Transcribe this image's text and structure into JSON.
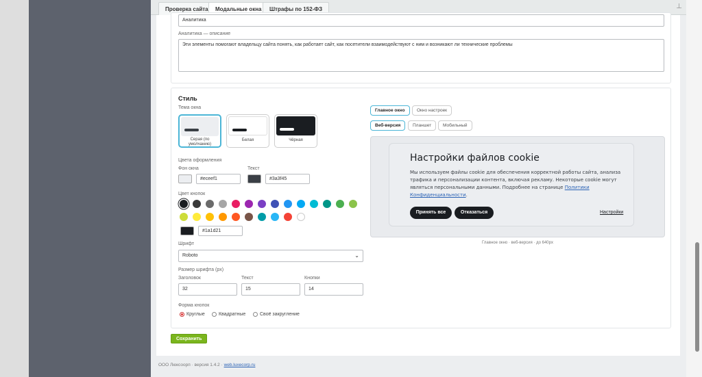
{
  "tabs": [
    {
      "label": "Проверка сайта"
    },
    {
      "label": "Модальные окна"
    },
    {
      "label": "Штрафы по 152-ФЗ"
    }
  ],
  "analytics": {
    "name_value": "Аналитика",
    "desc_label": "Аналитика — описание",
    "desc_value": "Эти элементы помогают владельцу сайта понять, как работает сайт, как посетители взаимодействуют с ним и возникают ли технические проблемы"
  },
  "style": {
    "title": "Стиль",
    "theme_label": "Тема окна",
    "themes": [
      {
        "label": "Серая (по умолчанию)",
        "bg": "#eceef1",
        "bar": "#3a3f45",
        "selected": true
      },
      {
        "label": "Белая",
        "bg": "#ffffff",
        "bar": "#1a1d21",
        "selected": false
      },
      {
        "label": "Чёрная",
        "bg": "#1a1d21",
        "bar": "#ffffff",
        "selected": false
      }
    ],
    "colors_label": "Цвета оформления",
    "bg_label": "Фон окна",
    "bg_value": "#eceef1",
    "text_label": "Текст",
    "text_value": "#3a3f45",
    "btn_color_label": "Цвет кнопок",
    "palette": [
      "#1a1d21",
      "#3a3a3a",
      "#6b6b6b",
      "#a6a6a6",
      "#e91e63",
      "#9c27b0",
      "#7b3fc4",
      "#3f51b5",
      "#2196f3",
      "#03a9f4",
      "#00bcd4",
      "#009688",
      "#4caf50",
      "#8bc34a",
      "#cddc39",
      "#ffeb3b",
      "#ffc107",
      "#ff9800",
      "#ff5722",
      "#795548",
      "#009ca8",
      "#29b6f6",
      "#f44336",
      "#ffffff"
    ],
    "selected_color": "#1a1d21",
    "custom_color_value": "#1a1d21",
    "font_label": "Шрифт",
    "font_value": "Roboto",
    "size_label": "Размер шрифта (px)",
    "size_heading_label": "Заголовок",
    "size_heading_value": "32",
    "size_text_label": "Текст",
    "size_text_value": "15",
    "size_buttons_label": "Кнопки",
    "size_buttons_value": "14",
    "shape_label": "Форма кнопок",
    "shape_options": [
      "Круглые",
      "Квадратные",
      "Своё закругление"
    ],
    "shape_selected": "Круглые"
  },
  "preview": {
    "window_tabs": [
      "Главное окно",
      "Окно настроек"
    ],
    "device_tabs": [
      "Веб-версия",
      "Планшет",
      "Мобильный"
    ],
    "modal_title": "Настройки файлов cookie",
    "modal_text": "Мы используем файлы cookie для обеспечения корректной работы сайта, анализа трафика и персонализации контента, включая рекламу. Некоторые cookie могут являться персональными данными. Подробнее на странице",
    "modal_link": "Политики Конфиденциальности",
    "accept_label": "Принять все",
    "decline_label": "Отказаться",
    "settings_label": "Настройки",
    "caption": "Главное окно · веб-версия · до 640px"
  },
  "save_label": "Сохранить",
  "footer": {
    "text": "ООО Люксоорп · версия 1.4.2 ·",
    "link": "web.luxecorp.ru"
  }
}
